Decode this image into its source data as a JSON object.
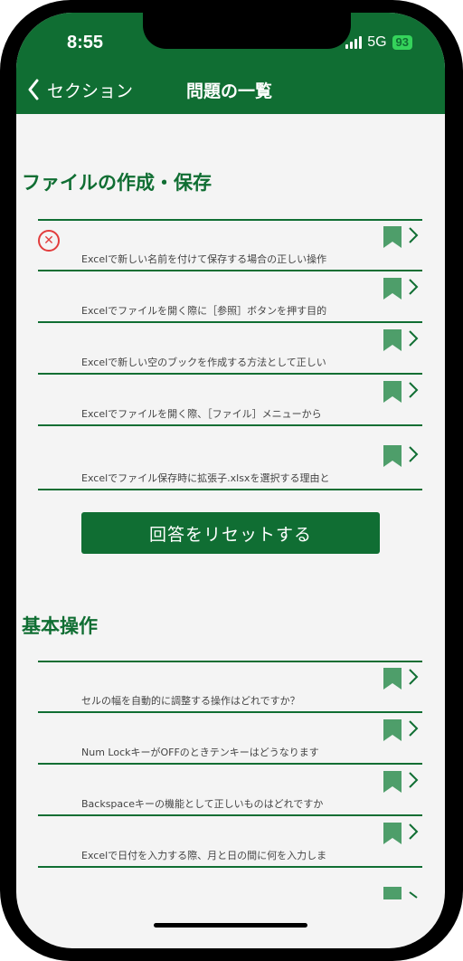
{
  "status_bar": {
    "time": "8:55",
    "network": "5G",
    "battery": "93"
  },
  "nav": {
    "back_label": "セクション",
    "title": "問題の一覧"
  },
  "sections": [
    {
      "title": "ファイルの作成・保存",
      "questions": [
        {
          "text": "Excelで新しい名前を付けて保存する場合の正しい操作",
          "status": "incorrect"
        },
        {
          "text": "Excelでファイルを開く際に［参照］ボタンを押す目的"
        },
        {
          "text": "Excelで新しい空のブックを作成する方法として正しい"
        },
        {
          "text": "Excelでファイルを開く際、［ファイル］メニューから"
        },
        {
          "text": "Excelでファイル保存時に拡張子.xlsxを選択する理由と"
        }
      ],
      "reset_label": "回答をリセットする"
    },
    {
      "title": "基本操作",
      "questions": [
        {
          "text": "セルの幅を自動的に調整する操作はどれですか？"
        },
        {
          "text": "Num LockキーがOFFのときテンキーはどうなります"
        },
        {
          "text": "Backspaceキーの機能として正しいものはどれですか"
        },
        {
          "text": "Excelで日付を入力する際、月と日の間に何を入力しま"
        }
      ]
    }
  ],
  "icons": {
    "incorrect_mark": "circle-x-icon",
    "bookmark": "bookmark-icon",
    "chevron": "chevron-right-icon",
    "back": "chevron-left-icon"
  },
  "colors": {
    "brand": "#106e33",
    "bookmark": "#4e9e6a",
    "incorrect": "#e23c3c",
    "background": "#f4f4f4"
  }
}
